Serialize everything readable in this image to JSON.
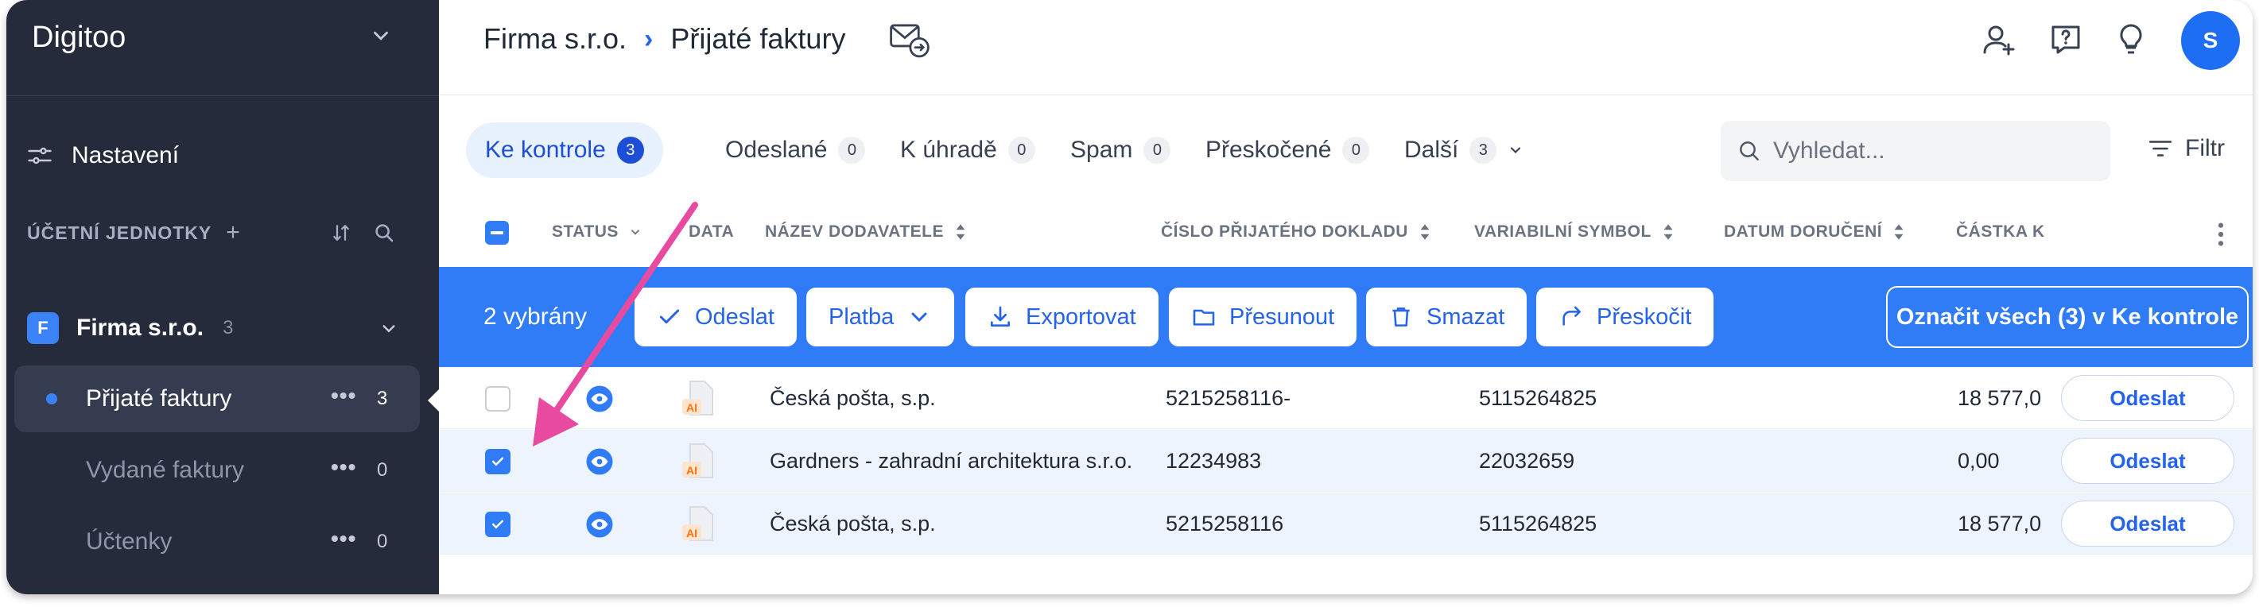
{
  "sidebar": {
    "brand": "Digitoo",
    "settings_label": "Nastavení",
    "section_label": "ÚČETNÍ JEDNOTKY",
    "section_add": "+",
    "company": {
      "badge": "F",
      "label": "Firma s.r.o.",
      "count": "3"
    },
    "items": [
      {
        "label": "Přijaté faktury",
        "more": "•••",
        "count": "3",
        "active": true
      },
      {
        "label": "Vydané faktury",
        "more": "•••",
        "count": "0",
        "active": false
      },
      {
        "label": "Účtenky",
        "more": "•••",
        "count": "0",
        "active": false
      }
    ]
  },
  "topbar": {
    "breadcrumb_parent": "Firma s.r.o.",
    "breadcrumb_sep": "›",
    "breadcrumb_current": "Přijaté faktury",
    "avatar_initial": "S"
  },
  "tabs": [
    {
      "label": "Ke kontrole",
      "count": "3"
    },
    {
      "label": "Odeslané",
      "count": "0"
    },
    {
      "label": "K úhradě",
      "count": "0"
    },
    {
      "label": "Spam",
      "count": "0"
    },
    {
      "label": "Přeskočené",
      "count": "0"
    },
    {
      "label": "Další",
      "count": "3"
    }
  ],
  "search": {
    "placeholder": "Vyhledat..."
  },
  "filter_label": "Filtr",
  "table": {
    "headers": {
      "status": "STATUS",
      "data": "DATA",
      "supplier": "NÁZEV DODAVATELE",
      "doc_number": "ČÍSLO PŘIJATÉHO DOKLADU",
      "var_symbol": "VARIABILNÍ SYMBOL",
      "delivery": "DATUM DORUČENÍ",
      "amount": "ČÁSTKA K"
    },
    "rows": [
      {
        "supplier": "Česká pošta, s.p.",
        "doc_number": "5215258116-",
        "var_symbol": "5115264825",
        "amount": "18 577,0",
        "action": "Odeslat",
        "checked": false
      },
      {
        "supplier": "Gardners - zahradní architektura s.r.o.",
        "doc_number": "12234983",
        "var_symbol": "22032659",
        "amount": "0,00",
        "action": "Odeslat",
        "checked": true
      },
      {
        "supplier": "Česká pošta, s.p.",
        "doc_number": "5215258116",
        "var_symbol": "5115264825",
        "amount": "18 577,0",
        "action": "Odeslat",
        "checked": true
      }
    ]
  },
  "actionbar": {
    "selected_label": "2 vybrány",
    "send": "Odeslat",
    "payment": "Platba",
    "export": "Exportovat",
    "move": "Přesunout",
    "delete": "Smazat",
    "skip": "Přeskočit",
    "select_all": "Označit všech (3) v Ke kontrole"
  },
  "doc_badge": "AI",
  "colors": {
    "sidebar_bg": "#262b3c",
    "accent": "#2f7cf6",
    "arrow": "#e84aa0"
  }
}
